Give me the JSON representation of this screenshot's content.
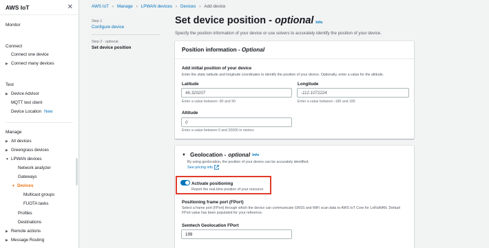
{
  "sidebar": {
    "title": "AWS IoT",
    "monitor": "Monitor",
    "connect": {
      "heading": "Connect",
      "items": [
        "Connect one device",
        "Connect many devices"
      ]
    },
    "test": {
      "heading": "Test",
      "items": [
        "Device Advisor",
        "MQTT test client",
        "Device Location"
      ],
      "new_badge": "New"
    },
    "manage": {
      "heading": "Manage",
      "items": [
        "All devices",
        "Greengrass devices",
        "LPWAN devices",
        "Network analyzer",
        "Gateways",
        "Devices",
        "Multicast groups",
        "FUOTA tasks",
        "Profiles",
        "Destinations",
        "Remote actions",
        "Message Routing"
      ]
    }
  },
  "breadcrumb": [
    "AWS IoT",
    "Manage",
    "LPWAN devices",
    "Devices",
    "Add device"
  ],
  "steps": {
    "step1_num": "Step 1",
    "step1_label": "Configure device",
    "step2_num": "Step 2 - optional",
    "step2_label": "Set device position"
  },
  "page": {
    "title": "Set device position - ",
    "title_optional": "optional",
    "info": "Info",
    "description": "Specify the position information of your device or use solvers to accurately identify the position of your device."
  },
  "position_panel": {
    "title": "Position information - ",
    "title_optional": "Optional",
    "add_label": "Add initial position of your device",
    "add_desc": "Enter the static latitude and longitude coordinates to identify the position of your device. Optionally, enter a value for the altitude.",
    "latitude_label": "Latitude",
    "latitude_value": "46.320207",
    "latitude_hint": "Enter a value between -90 and 90",
    "longitude_label": "Longitude",
    "longitude_value": "-112.1072224",
    "longitude_hint": "Enter a value between -180 and 180",
    "altitude_label": "Altitude",
    "altitude_value": "0",
    "altitude_hint": "Enter a value between 0 and 20000 in meters"
  },
  "geo_panel": {
    "title": "Geolocation - ",
    "title_optional": "optional",
    "info": "Info",
    "desc": "By using geolocation, the position of your device can be accurately identified.",
    "see_pricing": "See pricing info",
    "activate_label": "Activate positioning",
    "activate_desc": "Report the real-time position of your resource.",
    "activate_on": true,
    "frame_port_label": "Positioning frame port (FPort)",
    "frame_port_desc_1": "Select a frame port (FPort) through which the device can communicate GNSS and WiFi scan data to AWS IoT Core for LoRaWAN. Default",
    "frame_port_desc_2": "FPort value has been populated for your reference.",
    "semtech_label": "Semtech Geolocation FPort",
    "semtech_value": "199"
  },
  "colors": {
    "link": "#0073bb",
    "active_nav": "#ec7211",
    "highlight": "#e03a2a",
    "toggle_on": "#0073bb"
  }
}
